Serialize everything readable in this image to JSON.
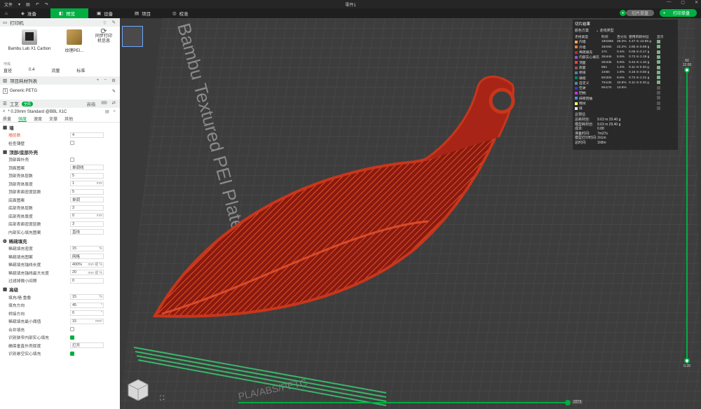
{
  "titlebar": {
    "file_menu": "文件",
    "title": "零件1"
  },
  "tabs": [
    {
      "label": "准备",
      "icon": "cube-icon"
    },
    {
      "label": "预览",
      "icon": "preview-icon"
    },
    {
      "label": "设备",
      "icon": "device-icon"
    },
    {
      "label": "项目",
      "icon": "project-icon"
    },
    {
      "label": "校准",
      "icon": "calibrate-icon"
    }
  ],
  "actions": {
    "slice_plate": "切片单盘",
    "print_plate": "打印单盘"
  },
  "printer": {
    "section_title": "打印机",
    "model": "Bambu Lab X1 Carbon",
    "plate": "纹理PEI...",
    "sync_label": "同步打印机信息",
    "nozzle_caption": "喷嘴",
    "diameter_label": "直径",
    "diameter_value": "0.4",
    "flow_label": "流量",
    "flow_value": "标准"
  },
  "filament": {
    "section_title": "项目耗材列表",
    "slot": "1",
    "name": "Generic PETG"
  },
  "process": {
    "section_title": "工艺",
    "toggle_label": "全局",
    "advanced_label": "高级",
    "preset": "* 0.20mm Standard @BBL X1C",
    "subtabs": [
      "质量",
      "强度",
      "速度",
      "支撑",
      "其他"
    ]
  },
  "groups": {
    "wall": "墙",
    "shell": "顶部/底部外壳",
    "infill": "稀疏填充",
    "advanced": "高级"
  },
  "wall_rows": [
    {
      "label": "墙层数",
      "value": "4",
      "unit": "",
      "highlight": true
    },
    {
      "label": "检查薄壁",
      "type": "checkbox",
      "checked": false
    }
  ],
  "shell_rows": [
    {
      "label": "顶部面外壳",
      "type": "checkbox",
      "checked": false
    },
    {
      "label": "顶面图案",
      "value": "单调线",
      "unit": ""
    },
    {
      "label": "顶部壳体层数",
      "value": "5",
      "unit": ""
    },
    {
      "label": "顶部壳体厚度",
      "value": "1",
      "unit": "mm"
    },
    {
      "label": "顶部表面密度层数",
      "value": "5",
      "unit": ""
    },
    {
      "label": "底面图案",
      "value": "单调",
      "unit": ""
    },
    {
      "label": "底部壳体层数",
      "value": "3",
      "unit": ""
    },
    {
      "label": "底部壳体厚度",
      "value": "0",
      "unit": "mm"
    },
    {
      "label": "底部表面密度层数",
      "value": "3",
      "unit": ""
    },
    {
      "label": "内部实心填充图案",
      "value": "直线",
      "unit": ""
    }
  ],
  "infill_rows": [
    {
      "label": "稀疏填充密度",
      "value": "15",
      "unit": "%"
    },
    {
      "label": "稀疏填充图案",
      "value": "网格",
      "unit": ""
    },
    {
      "label": "稀疏填充锚线长度",
      "value": "400%",
      "unit": "mm 或 %"
    },
    {
      "label": "稀疏填充锚线最大长度",
      "value": "20",
      "unit": "mm 或 %"
    },
    {
      "label": "过滤掉微小间隙",
      "value": "0",
      "unit": ""
    }
  ],
  "advanced_rows": [
    {
      "label": "填充/墙 重叠",
      "value": "15",
      "unit": "%"
    },
    {
      "label": "填充方向",
      "value": "45",
      "unit": "°"
    },
    {
      "label": "桥接方向",
      "value": "0",
      "unit": "°"
    },
    {
      "label": "稀疏填充最小阈值",
      "value": "15",
      "unit": "mm²"
    },
    {
      "label": "合并填充",
      "type": "checkbox",
      "checked": false
    },
    {
      "label": "识别狭窄内部实心填充",
      "type": "checkbox",
      "checked": true
    },
    {
      "label": "确保垂直外壳厚度",
      "value": "打开",
      "unit": ""
    },
    {
      "label": "识别悬空实心填充",
      "type": "checkbox",
      "checked": true
    }
  ],
  "plate_text": [
    "Bambu Textured PEI Plate",
    "PLA/ABS/PETG"
  ],
  "legend": {
    "title": "切片结果",
    "scheme_label": "颜色方案",
    "scheme_value": "走线类型",
    "headers": [
      "走线类型",
      "时间",
      "百分比",
      "使用的耗材丝",
      "显示"
    ],
    "rows": [
      {
        "name": "内墙",
        "time": "19m56s",
        "pct": "29.3%",
        "used": "4.47 m  13.65 g",
        "color": "#ffa64d",
        "show": true
      },
      {
        "name": "外墙",
        "time": "15m6s",
        "pct": "22.2%",
        "used": "2.85 m  8.69 g",
        "color": "#ff7d38",
        "show": true
      },
      {
        "name": "稀疏填充",
        "time": "17s",
        "pct": "0.4%",
        "used": "0.05 m  0.17 g",
        "color": "#b03029",
        "show": true
      },
      {
        "name": "内部实心填充",
        "time": "3m44s",
        "pct": "5.5%",
        "used": "0.72 m  2.19 g",
        "color": "#9654cc",
        "show": true
      },
      {
        "name": "顶面",
        "time": "3m43s",
        "pct": "5.5%",
        "used": "0.44 m  1.34 g",
        "color": "#f04040",
        "show": true
      },
      {
        "name": "底面",
        "time": "55s",
        "pct": "1.4%",
        "used": "0.11 m  0.33 g",
        "color": "#a14d4d",
        "show": true
      },
      {
        "name": "桥接",
        "time": "1m6s",
        "pct": "1.6%",
        "used": "0.16 m  0.50 g",
        "color": "#4d80ba",
        "show": true
      },
      {
        "name": "填缝",
        "time": "6m32s",
        "pct": "9.6%",
        "used": "0.72 m  2.21 g",
        "color": "#00875a",
        "show": true
      },
      {
        "name": "自定义",
        "time": "7m13s",
        "pct": "10.6%",
        "used": "0.11 m  0.33 g",
        "color": "#5e8a8a",
        "show": true
      },
      {
        "name": "空驶",
        "time": "9m17s",
        "pct": "13.6%",
        "used": "",
        "color": "#3636dd",
        "show": false
      },
      {
        "name": "回抽",
        "time": "",
        "pct": "",
        "used": "",
        "color": "#cc33cc",
        "show": false
      },
      {
        "name": "抹擦回抽",
        "time": "",
        "pct": "",
        "used": "",
        "color": "#3399ff",
        "show": false
      },
      {
        "name": "擦拭",
        "time": "",
        "pct": "",
        "used": "",
        "color": "#ffff66",
        "show": false
      },
      {
        "name": "缝",
        "time": "",
        "pct": "",
        "used": "",
        "color": "#e6e6e6",
        "show": false
      }
    ],
    "summary_title": "总预估",
    "summary": [
      {
        "k": "总耗材丝:",
        "v": "9.63 m    29.40 g"
      },
      {
        "k": "模型耗材丝:",
        "v": "9.63 m    29.40 g"
      },
      {
        "k": "成本:",
        "v": "0.88"
      },
      {
        "k": "准备时间:",
        "v": "7m27s"
      },
      {
        "k": "模型打印时间:",
        "v": "1h1m"
      },
      {
        "k": "总时间:",
        "v": "1h8m"
      }
    ]
  },
  "layer_slider": {
    "top_layer": "60",
    "top_height": "12.00",
    "bottom_layer": "1",
    "bottom_height": "0.20"
  },
  "move_slider": {
    "value": "2273",
    "position_pct": 100
  }
}
